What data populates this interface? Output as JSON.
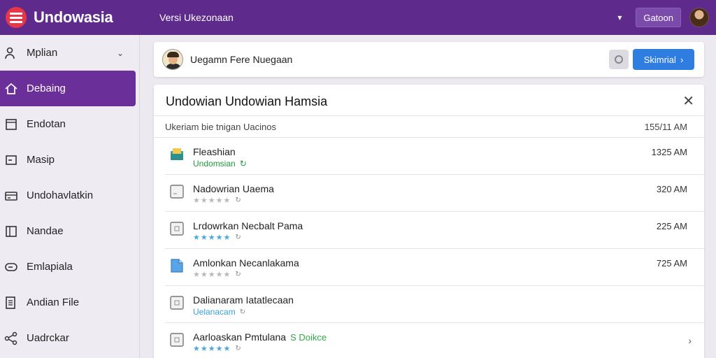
{
  "topbar": {
    "app_name": "Undowasia",
    "version": "Versi Ukezonaan",
    "button": "Gatoon"
  },
  "sidebar": {
    "items": [
      {
        "label": "Mplian",
        "icon": "users-icon",
        "active": false,
        "chevron": true
      },
      {
        "label": "Debaing",
        "icon": "home-icon",
        "active": true
      },
      {
        "label": "Endotan",
        "icon": "document-icon",
        "active": false
      },
      {
        "label": "Masip",
        "icon": "minus-box-icon",
        "active": false
      },
      {
        "label": "Undohavlatkin",
        "icon": "card-icon",
        "active": false
      },
      {
        "label": "Nandae",
        "icon": "book-icon",
        "active": false
      },
      {
        "label": "Emlapiala",
        "icon": "toggle-icon",
        "active": false
      },
      {
        "label": "Andian File",
        "icon": "file-list-icon",
        "active": false
      },
      {
        "label": "Uadrckar",
        "icon": "share-icon",
        "active": false
      }
    ]
  },
  "header": {
    "text": "Uegamn Fere Nuegaan",
    "primary_button": "Skimrial"
  },
  "panel": {
    "title": "Undowian Undowian Hamsia",
    "sub_label": "Ukeriam bie tnigan Uacinos",
    "sub_time": "155/11 AM",
    "rows": [
      {
        "title": "Fleashian",
        "sub": "Undomsian",
        "sub_style": "green",
        "icon": "folder-icon",
        "time": "1325 AM"
      },
      {
        "title": "Nadowrian Uaema",
        "sub": "★★★★★",
        "sub_style": "stars-gray",
        "icon": "document-icon",
        "time": "320 AM"
      },
      {
        "title": "Lrdowrkan Necbalt Pama",
        "sub": "★★★★★",
        "sub_style": "stars-blue",
        "icon": "document-icon",
        "time": "225 AM"
      },
      {
        "title": "Amlonkan Necanlakama",
        "sub": "★★★★★",
        "sub_style": "stars-gray",
        "icon": "blue-file-icon",
        "time": "725 AM"
      },
      {
        "title": "Dalianaram Iatatlecaan",
        "sub": "Uelanacam",
        "sub_style": "blue",
        "icon": "document-icon",
        "time": ""
      },
      {
        "title": "Aarloaskan Pmtulana",
        "sub": "★★★★★",
        "sub_style": "stars-blue",
        "icon": "document-icon",
        "time": "",
        "tag": "S Doikce",
        "chevron": true
      }
    ]
  }
}
